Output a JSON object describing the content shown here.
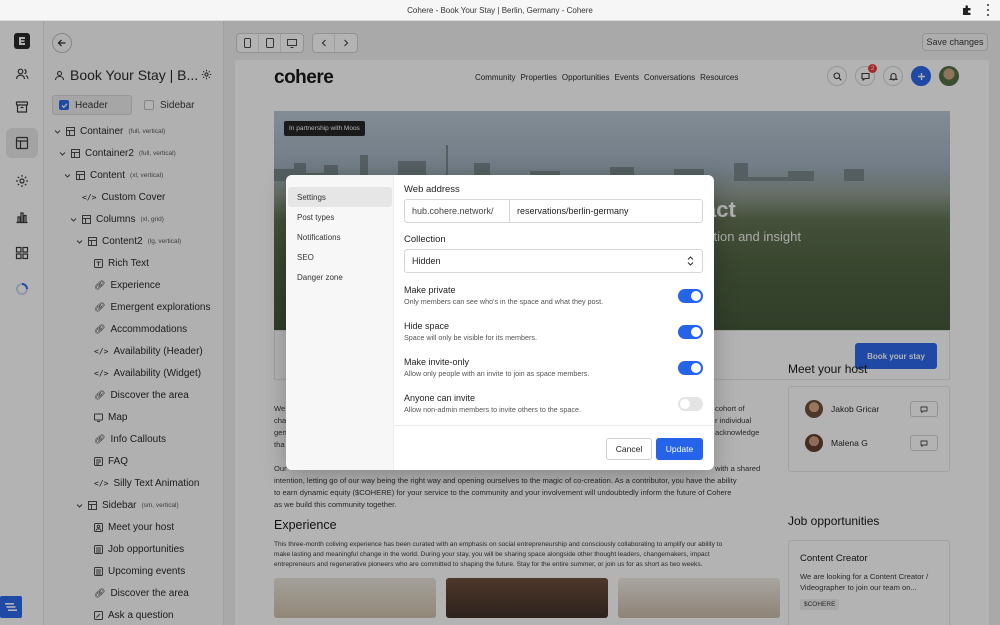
{
  "window": {
    "title": "Cohere - Book Your Stay | Berlin, Germany - Cohere"
  },
  "rail": {
    "items": [
      "logo-icon",
      "members-icon",
      "archive-icon",
      "layout-icon",
      "settings-icon",
      "analytics-icon",
      "apps-icon",
      "loading-icon"
    ]
  },
  "panel": {
    "title": "Book Your Stay | B...",
    "toggles": {
      "header": "Header",
      "sidebar": "Sidebar"
    },
    "tree": [
      {
        "label": "Container",
        "meta": "(full, vertical)"
      },
      {
        "label": "Container2",
        "meta": "(full, vertical)"
      },
      {
        "label": "Content",
        "meta": "(xl, vertical)"
      },
      {
        "label": "Custom Cover",
        "meta": ""
      },
      {
        "label": "Columns",
        "meta": "(xl, grid)"
      },
      {
        "label": "Content2",
        "meta": "(lg, vertical)"
      },
      {
        "label": "Rich Text",
        "meta": ""
      },
      {
        "label": "Experience",
        "meta": ""
      },
      {
        "label": "Emergent explorations",
        "meta": ""
      },
      {
        "label": "Accommodations",
        "meta": ""
      },
      {
        "label": "Availability (Header)",
        "meta": ""
      },
      {
        "label": "Availability (Widget)",
        "meta": ""
      },
      {
        "label": "Discover the area",
        "meta": ""
      },
      {
        "label": "Map",
        "meta": ""
      },
      {
        "label": "Info Callouts",
        "meta": ""
      },
      {
        "label": "FAQ",
        "meta": ""
      },
      {
        "label": "Silly Text Animation",
        "meta": ""
      },
      {
        "label": "Sidebar",
        "meta": "(sm, vertical)"
      },
      {
        "label": "Meet your host",
        "meta": ""
      },
      {
        "label": "Job opportunities",
        "meta": ""
      },
      {
        "label": "Upcoming events",
        "meta": ""
      },
      {
        "label": "Discover the area",
        "meta": ""
      },
      {
        "label": "Ask a question",
        "meta": ""
      }
    ]
  },
  "toolbar": {
    "save_label": "Save changes"
  },
  "site": {
    "logo": "cohere",
    "nav": [
      "Community",
      "Properties",
      "Opportunities",
      "Events",
      "Conversations",
      "Resources"
    ],
    "notification_count": "2",
    "hero_tag": "In partnership with Moos",
    "hero_heading": "act",
    "hero_sub": "ction and insight",
    "book_button": "Book your stay",
    "para1": [
      "We",
      "cha",
      "gen",
      "tha"
    ],
    "para1_right": [
      "cohort of",
      "r individual",
      "acknowledge"
    ],
    "para2_l1": "Our",
    "para2_l1_right": "with a shared",
    "para2_l2": "intention, letting go of our way being the right way and opening ourselves to the magic of co-creation. As a contributor, you have the ability",
    "para2_l3": "to earn dynamic equity ($COHERE) for your service to the community and your involvement will undoubtedly inform the future of Cohere",
    "para2_l4": "as we build this community together.",
    "experience_heading": "Experience",
    "experience_text": [
      "This three-month coliving experience has been curated with an emphasis on social entrepreneurship and consciously collaborating to amplify our ability to",
      "make lasting and meaningful change in the world. During your stay, you will be sharing space alongside other thought leaders, changemakers, impact",
      "entrepreneurs and regenerative pioneers who are committed to shaping the future. Stay for the entire summer, or join us for as short as two weeks."
    ],
    "host_heading": "Meet your host",
    "hosts": [
      "Jakob Gricar",
      "Malena G"
    ],
    "jobs_heading": "Job opportunities",
    "job": {
      "title": "Content Creator",
      "desc": "We are looking for a Content Creator / Videographer to join our team on...",
      "tag": "$COHERE"
    }
  },
  "modal": {
    "nav": [
      "Settings",
      "Post types",
      "Notifications",
      "SEO",
      "Danger zone"
    ],
    "web_address_label": "Web address",
    "url_prefix": "hub.cohere.network/",
    "url_slug": "reservations/berlin-germany",
    "collection_label": "Collection",
    "collection_value": "Hidden",
    "options": [
      {
        "title": "Make private",
        "desc": "Only members can see who's in the space and what they post.",
        "on": true
      },
      {
        "title": "Hide space",
        "desc": "Space will only be visible for its members.",
        "on": true
      },
      {
        "title": "Make invite-only",
        "desc": "Allow only people with an invite to join as space members.",
        "on": true
      },
      {
        "title": "Anyone can invite",
        "desc": "Allow non-admin members to invite others to the space.",
        "on": false
      }
    ],
    "cancel": "Cancel",
    "update": "Update"
  }
}
